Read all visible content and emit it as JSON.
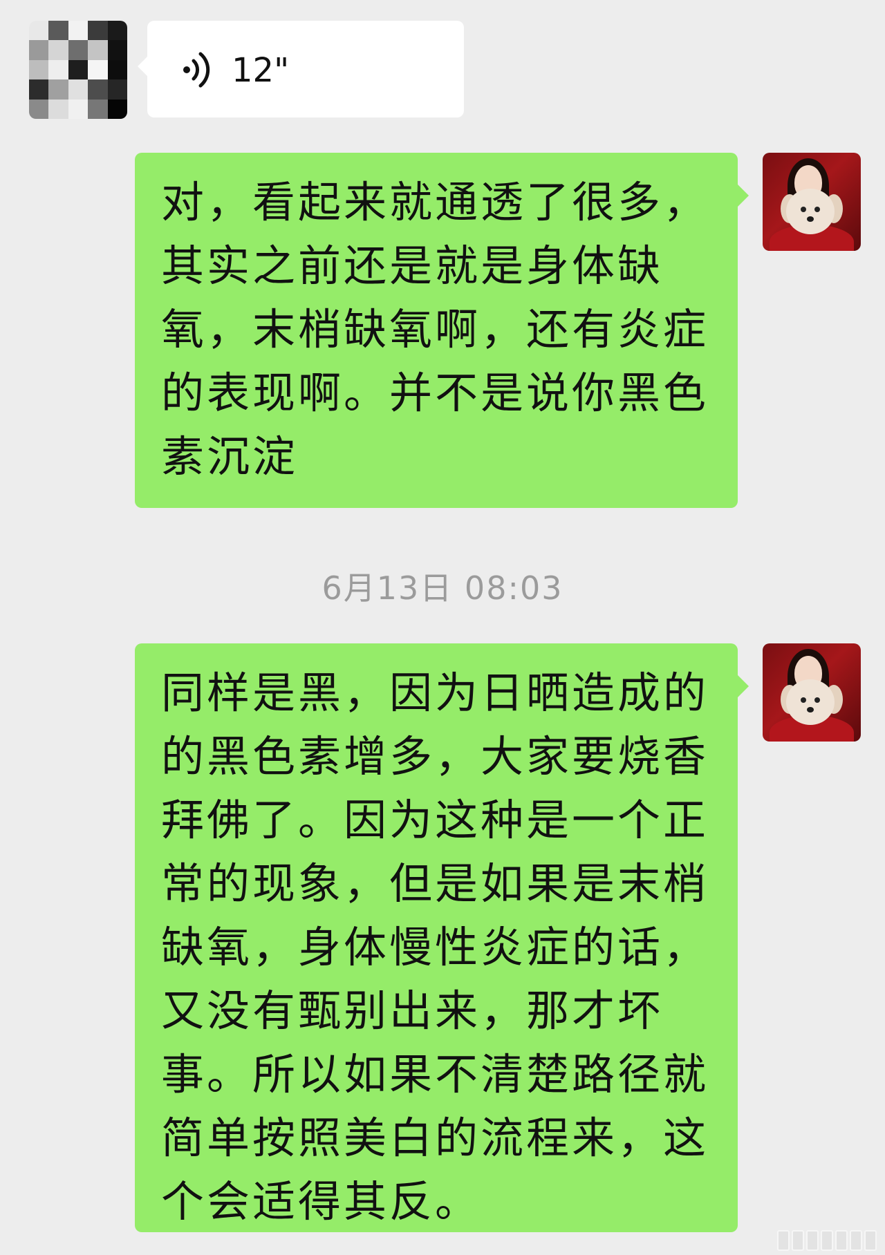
{
  "conversation": {
    "incoming_voice": {
      "duration": "12\"",
      "icon": "voice-wave-icon"
    },
    "messages": [
      {
        "text": "对，看起来就通透了很多，\n其实之前还是就是身体缺\n氧，末梢缺氧啊，还有炎症\n的表现啊。并不是说你黑色\n素沉淀"
      },
      {
        "text": "同样是黑，因为日晒造成的\n的黑色素增多，大家要烧香\n拜佛了。因为这种是一个正\n常的现象，但是如果是末梢\n缺氧，身体慢性炎症的话，\n又没有甄别出来，那才坏\n事。所以如果不清楚路径就\n简单按照美白的流程来，这\n个会适得其反。"
      }
    ],
    "timestamp": "6月13日 08:03"
  },
  "colors": {
    "background": "#ededed",
    "outgoing_bubble": "#95ec69",
    "incoming_bubble": "#ffffff",
    "timestamp_text": "#9b9b9b"
  }
}
